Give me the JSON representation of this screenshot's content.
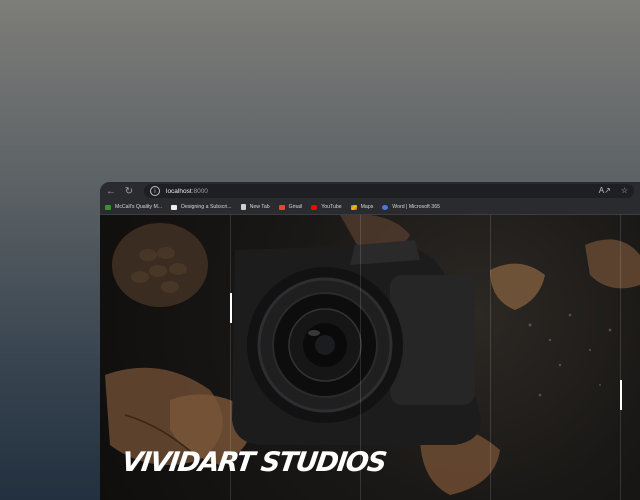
{
  "browser": {
    "address": {
      "host": "localhost",
      "port": ":8000"
    },
    "bookmarks": [
      {
        "label": "McCall's Quality M...",
        "icon": "mccalls-icon",
        "color": "#3a8f3a"
      },
      {
        "label": "Designing a Subscri...",
        "icon": "video-icon",
        "color": "#eeeeee"
      },
      {
        "label": "New Tab",
        "icon": "page-icon",
        "color": "#cfcfcf"
      },
      {
        "label": "Gmail",
        "icon": "gmail-icon",
        "color": "#ea4335"
      },
      {
        "label": "YouTube",
        "icon": "youtube-icon",
        "color": "#ff0000"
      },
      {
        "label": "Maps",
        "icon": "maps-icon",
        "color": "#34a853"
      },
      {
        "label": "Word | Microsoft 365",
        "icon": "word-icon",
        "color": "#4a7bd8"
      }
    ]
  },
  "hero": {
    "title": "VIVIDART STUDIOS"
  }
}
